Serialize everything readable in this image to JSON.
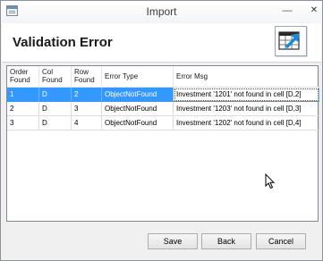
{
  "window": {
    "title": "Import"
  },
  "titlebar": {
    "minimize_glyph": "—",
    "close_glyph": "✕"
  },
  "header": {
    "title": "Validation Error",
    "icon": "table-arrow-icon"
  },
  "grid": {
    "columns": [
      {
        "label": "Order\nFound"
      },
      {
        "label": "Col\nFound"
      },
      {
        "label": "Row\nFound"
      },
      {
        "label": "Error Type"
      },
      {
        "label": "Error Msg"
      }
    ],
    "rows": [
      {
        "order": "1",
        "col": "D",
        "row": "2",
        "type": "ObjectNotFound",
        "msg": "Investment '1201' not found in cell [D,2]",
        "selected": true
      },
      {
        "order": "2",
        "col": "D",
        "row": "3",
        "type": "ObjectNotFound",
        "msg": "Investment '1203' not found in cell [D,3]",
        "selected": false
      },
      {
        "order": "3",
        "col": "D",
        "row": "4",
        "type": "ObjectNotFound",
        "msg": "Investment '1202' not found in cell [D,4]",
        "selected": false
      }
    ]
  },
  "buttons": {
    "save": "Save",
    "back": "Back",
    "cancel": "Cancel"
  },
  "colors": {
    "selection": "#3399ff",
    "window_bg": "#f0f0f0",
    "icon_accent": "#1c8ad9"
  }
}
